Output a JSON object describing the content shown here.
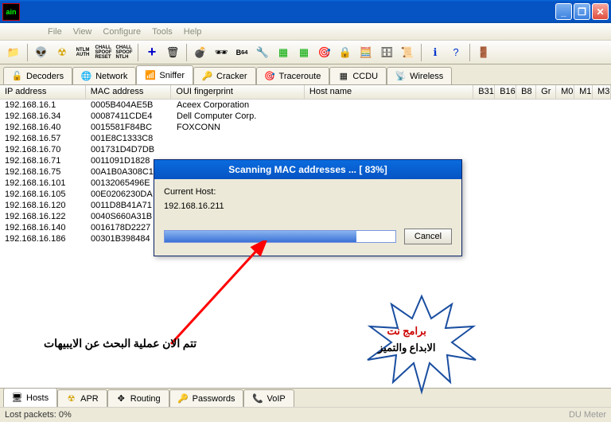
{
  "menu": {
    "file": "File",
    "view": "View",
    "configure": "Configure",
    "tools": "Tools",
    "help": "Help"
  },
  "tabs": {
    "decoders": "Decoders",
    "network": "Network",
    "sniffer": "Sniffer",
    "cracker": "Cracker",
    "traceroute": "Traceroute",
    "ccdu": "CCDU",
    "wireless": "Wireless"
  },
  "cols": {
    "ip": "IP address",
    "mac": "MAC address",
    "oui": "OUI fingerprint",
    "host": "Host name",
    "b31": "B31",
    "b16": "B16",
    "b8": "B8",
    "gr": "Gr",
    "m0": "M0",
    "m1": "M1",
    "m3": "M3"
  },
  "rows": [
    {
      "ip": "192.168.16.1",
      "mac": "0005B404AE5B",
      "oui": "Aceex Corporation"
    },
    {
      "ip": "192.168.16.34",
      "mac": "00087411CDE4",
      "oui": "Dell Computer Corp."
    },
    {
      "ip": "192.168.16.40",
      "mac": "0015581F84BC",
      "oui": "FOXCONN"
    },
    {
      "ip": "192.168.16.57",
      "mac": "001E8C1333C8",
      "oui": ""
    },
    {
      "ip": "192.168.16.70",
      "mac": "001731D4D7DB",
      "oui": ""
    },
    {
      "ip": "192.168.16.71",
      "mac": "0011091D1828",
      "oui": ""
    },
    {
      "ip": "192.168.16.75",
      "mac": "00A1B0A308C1",
      "oui": ""
    },
    {
      "ip": "192.168.16.101",
      "mac": "00132065496E",
      "oui": ""
    },
    {
      "ip": "192.168.16.105",
      "mac": "00E0206230DA",
      "oui": ""
    },
    {
      "ip": "192.168.16.120",
      "mac": "0011D8B41A71",
      "oui": ""
    },
    {
      "ip": "192.168.16.122",
      "mac": "0040S660A31B",
      "oui": ""
    },
    {
      "ip": "192.168.16.140",
      "mac": "0016178D2227",
      "oui": ""
    },
    {
      "ip": "192.168.16.186",
      "mac": "00301B398484",
      "oui": ""
    }
  ],
  "bottabs": {
    "hosts": "Hosts",
    "apr": "APR",
    "routing": "Routing",
    "passwords": "Passwords",
    "voip": "VoIP"
  },
  "status": {
    "lost": "Lost packets:   0%",
    "meter": "DU Meter"
  },
  "dialog": {
    "title": "Scanning MAC addresses ... [ 83%]",
    "label": "Current Host:",
    "host": "192.168.16.211",
    "cancel": "Cancel",
    "percent": 83
  },
  "ann": {
    "search": "تتم الان عملية البحث عن الايبيهات",
    "star1": "برامج نت",
    "star2": "الابداع والتميز"
  },
  "colw": {
    "ip": 108,
    "mac": 108,
    "oui": 168,
    "host": 213,
    "b31": 27,
    "b16": 27,
    "b8": 25,
    "gr": 25,
    "m0": 23,
    "m1": 23,
    "m3": 23
  }
}
